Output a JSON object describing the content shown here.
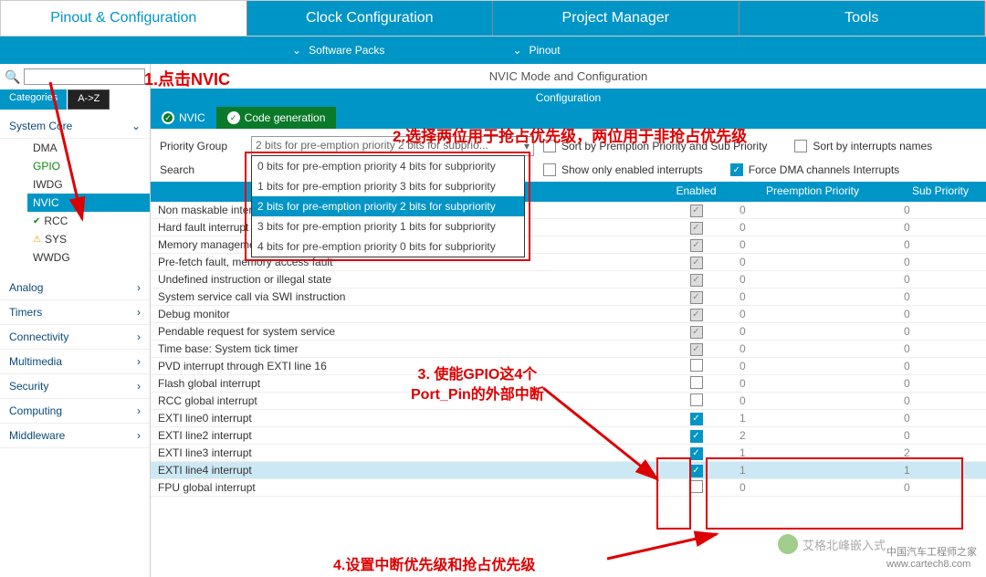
{
  "top_tabs": {
    "t0": "Pinout & Configuration",
    "t1": "Clock Configuration",
    "t2": "Project Manager",
    "t3": "Tools"
  },
  "sub_bar": {
    "s0": "Software Packs",
    "s1": "Pinout"
  },
  "sidebar": {
    "cat_tab": "Categories",
    "az_tab": "A->Z",
    "groups": {
      "g0": "System Core",
      "g1": "Analog",
      "g2": "Timers",
      "g3": "Connectivity",
      "g4": "Multimedia",
      "g5": "Security",
      "g6": "Computing",
      "g7": "Middleware"
    },
    "core": {
      "i0": "DMA",
      "i1": "GPIO",
      "i2": "IWDG",
      "i3": "NVIC",
      "i4": "RCC",
      "i5": "SYS",
      "i6": "WWDG"
    }
  },
  "content": {
    "title": "NVIC Mode and Configuration",
    "cfg": "Configuration",
    "tab0": "NVIC",
    "tab1": "Code generation",
    "pg_label": "Priority Group",
    "search_label": "Search",
    "pg_sel": "2 bits for pre-emption priority 2 bits for subprio...",
    "dd": {
      "d0": "0 bits for pre-emption priority 4 bits for subpriority",
      "d1": "1 bits for pre-emption priority 3 bits for subpriority",
      "d2": "2 bits for pre-emption priority 2 bits for subpriority",
      "d3": "3 bits for pre-emption priority 1 bits for subpriority",
      "d4": "4 bits for pre-emption priority 0 bits for subpriority"
    },
    "chks": {
      "c0": "Sort by Premption Priority and Sub Priority",
      "c1": "Sort by interrupts names",
      "c2": "Show only enabled interrupts",
      "c3": "Force DMA channels Interrupts"
    },
    "cols": {
      "en": "Enabled",
      "pp": "Preemption Priority",
      "sp": "Sub Priority"
    },
    "rows": [
      {
        "n": "Non maskable interrupt",
        "en": "d",
        "pp": "0",
        "sp": "0"
      },
      {
        "n": "Hard fault interrupt",
        "en": "d",
        "pp": "0",
        "sp": "0"
      },
      {
        "n": "Memory management fault",
        "en": "d",
        "pp": "0",
        "sp": "0"
      },
      {
        "n": "Pre-fetch fault, memory access fault",
        "en": "d",
        "pp": "0",
        "sp": "0"
      },
      {
        "n": "Undefined instruction or illegal state",
        "en": "d",
        "pp": "0",
        "sp": "0"
      },
      {
        "n": "System service call via SWI instruction",
        "en": "d",
        "pp": "0",
        "sp": "0"
      },
      {
        "n": "Debug monitor",
        "en": "d",
        "pp": "0",
        "sp": "0"
      },
      {
        "n": "Pendable request for system service",
        "en": "d",
        "pp": "0",
        "sp": "0"
      },
      {
        "n": "Time base: System tick timer",
        "en": "d",
        "pp": "0",
        "sp": "0"
      },
      {
        "n": "PVD interrupt through EXTI line 16",
        "en": "o",
        "pp": "0",
        "sp": "0"
      },
      {
        "n": "Flash global interrupt",
        "en": "o",
        "pp": "0",
        "sp": "0"
      },
      {
        "n": "RCC global interrupt",
        "en": "o",
        "pp": "0",
        "sp": "0"
      },
      {
        "n": "EXTI line0 interrupt",
        "en": "c",
        "pp": "1",
        "sp": "0"
      },
      {
        "n": "EXTI line2 interrupt",
        "en": "c",
        "pp": "2",
        "sp": "0"
      },
      {
        "n": "EXTI line3 interrupt",
        "en": "c",
        "pp": "1",
        "sp": "2"
      },
      {
        "n": "EXTI line4 interrupt",
        "en": "c",
        "pp": "1",
        "sp": "1",
        "sel": true
      },
      {
        "n": "FPU global interrupt",
        "en": "o",
        "pp": "0",
        "sp": "0"
      }
    ]
  },
  "notes": {
    "n1": "1.点击NVIC",
    "n2": "2.选择两位用于抢占优先级，两位用于非抢占优先级",
    "n3a": "3. 使能GPIO这4个",
    "n3b": "Port_Pin的外部中断",
    "n4": "4.设置中断优先级和抢占优先级"
  },
  "watermark": {
    "url": "www.cartech8.com",
    "brand": "艾格北峰嵌入式",
    "sub": "中国汽车工程师之家"
  }
}
